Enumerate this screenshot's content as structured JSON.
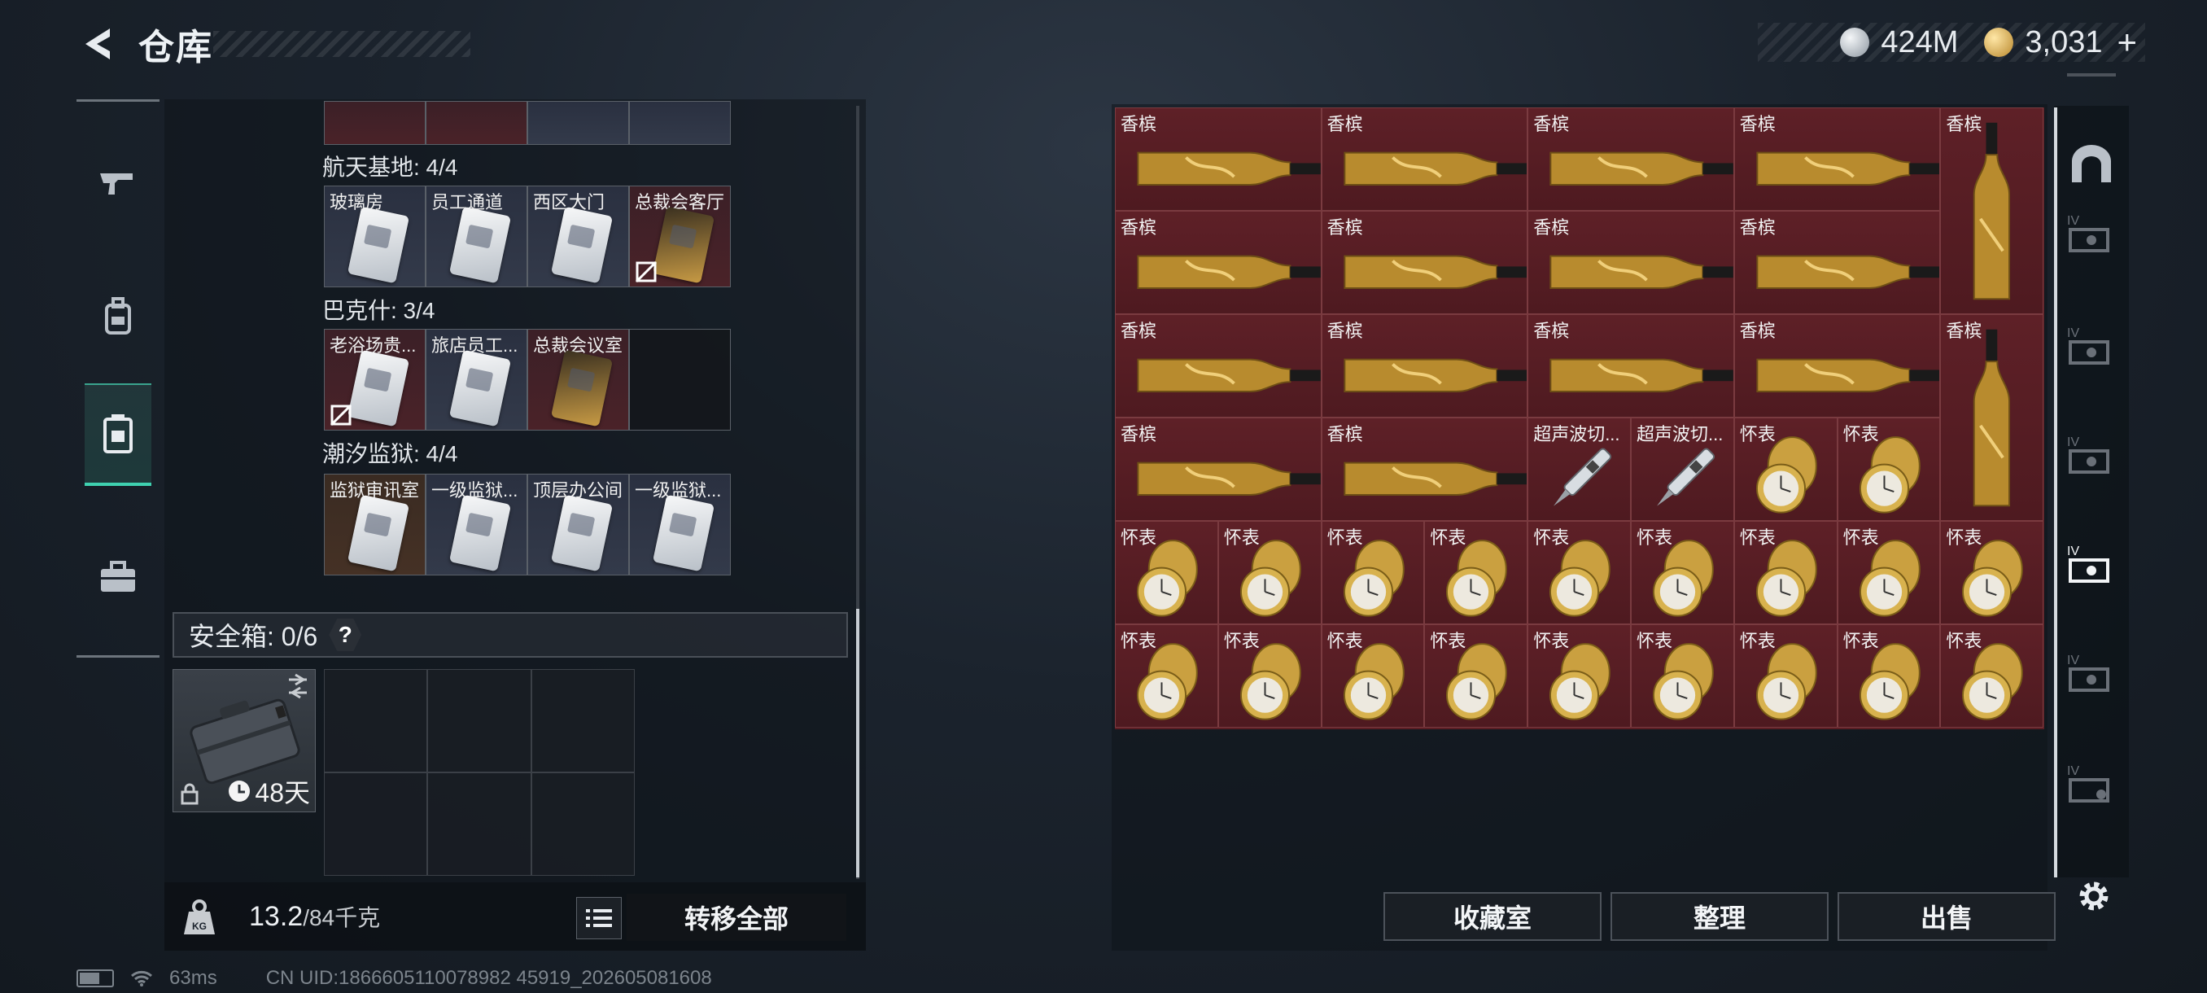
{
  "header": {
    "title": "仓库",
    "currency_silver": "424M",
    "currency_gold": "3,031",
    "add_symbol": "+"
  },
  "nav": {
    "items": [
      {
        "icon": "gun-icon"
      },
      {
        "icon": "backpack-icon"
      },
      {
        "icon": "storage-case-icon",
        "active": true
      },
      {
        "icon": "toolbox-icon"
      }
    ]
  },
  "keys": {
    "region1_label": "航天基地: 4/4",
    "region1": [
      {
        "name": "玻璃房",
        "style": "blue"
      },
      {
        "name": "员工通道",
        "style": "blue"
      },
      {
        "name": "西区大门",
        "style": "blue"
      },
      {
        "name": "总裁会客厅",
        "style": "red"
      }
    ],
    "region2_label": "巴克什: 3/4",
    "region2": [
      {
        "name": "老浴场贵...",
        "style": "red"
      },
      {
        "name": "旅店员工...",
        "style": "blue"
      },
      {
        "name": "总裁会议室",
        "style": "red"
      }
    ],
    "region3_label": "潮汐监狱: 4/4",
    "region3": [
      {
        "name": "监狱审讯室",
        "style": "brown"
      },
      {
        "name": "一级监狱...",
        "style": "blue"
      },
      {
        "name": "顶层办公间",
        "style": "blue"
      },
      {
        "name": "一级监狱...",
        "style": "blue"
      }
    ]
  },
  "safebox": {
    "label": "安全箱: 0/6",
    "help": "?",
    "timer": "48天"
  },
  "footer_left": {
    "weight": "13.2",
    "weight_max": "/84千克",
    "transfer_label": "转移全部"
  },
  "status": {
    "ping": "63ms",
    "uid": "CN UID:1866605110078982 45919_202605081608"
  },
  "stash": {
    "items": {
      "champagne": "香槟",
      "ultrasonic": "超声波切...",
      "pocketwatch": "怀表"
    }
  },
  "stash_buttons": {
    "collection": "收藏室",
    "sort": "整理",
    "sell": "出售"
  }
}
